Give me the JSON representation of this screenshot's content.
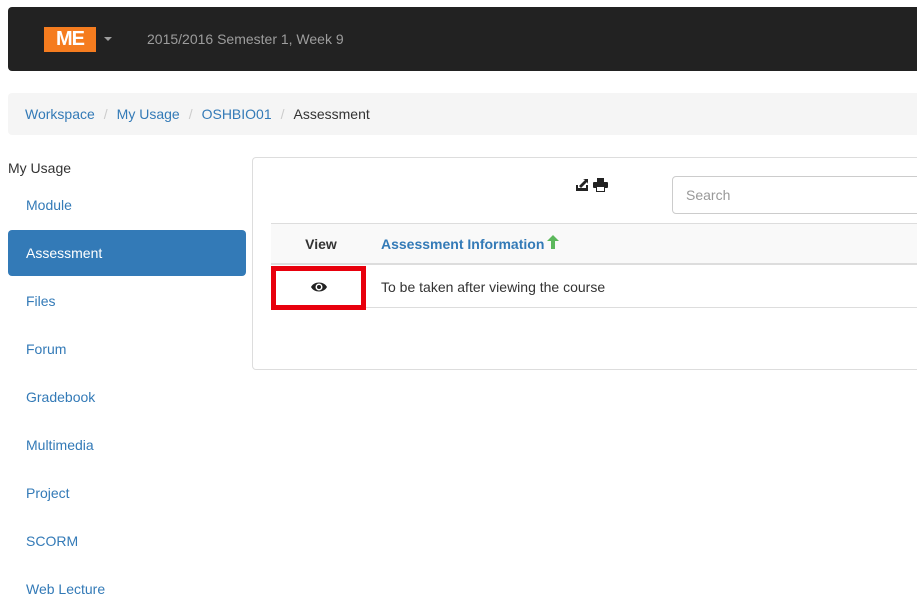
{
  "header": {
    "logo_text": "ME",
    "term": "2015/2016 Semester 1, Week 9"
  },
  "breadcrumb": {
    "items": [
      "Workspace",
      "My Usage",
      "OSHBIO01"
    ],
    "current": "Assessment",
    "separator": "/"
  },
  "sidebar": {
    "title": "My Usage",
    "items": [
      {
        "label": "Module"
      },
      {
        "label": "Assessment"
      },
      {
        "label": "Files"
      },
      {
        "label": "Forum"
      },
      {
        "label": "Gradebook"
      },
      {
        "label": "Multimedia"
      },
      {
        "label": "Project"
      },
      {
        "label": "SCORM"
      },
      {
        "label": "Web Lecture"
      }
    ],
    "active": "Assessment"
  },
  "panel": {
    "search": {
      "placeholder": "Search",
      "value": ""
    },
    "table": {
      "columns": [
        "View",
        "Assessment Information"
      ],
      "sort_column": "Assessment Information",
      "sort_direction": "ascending",
      "rows": [
        {
          "view": "eye-icon",
          "info": "To be taken after viewing the course"
        }
      ]
    }
  },
  "colors": {
    "navbar": "#222222",
    "logo": "#f57c1f",
    "link": "#337ab7",
    "active_nav": "#337ab7",
    "sort_arrow": "#5cb85c",
    "highlight_box": "#e8000d"
  }
}
